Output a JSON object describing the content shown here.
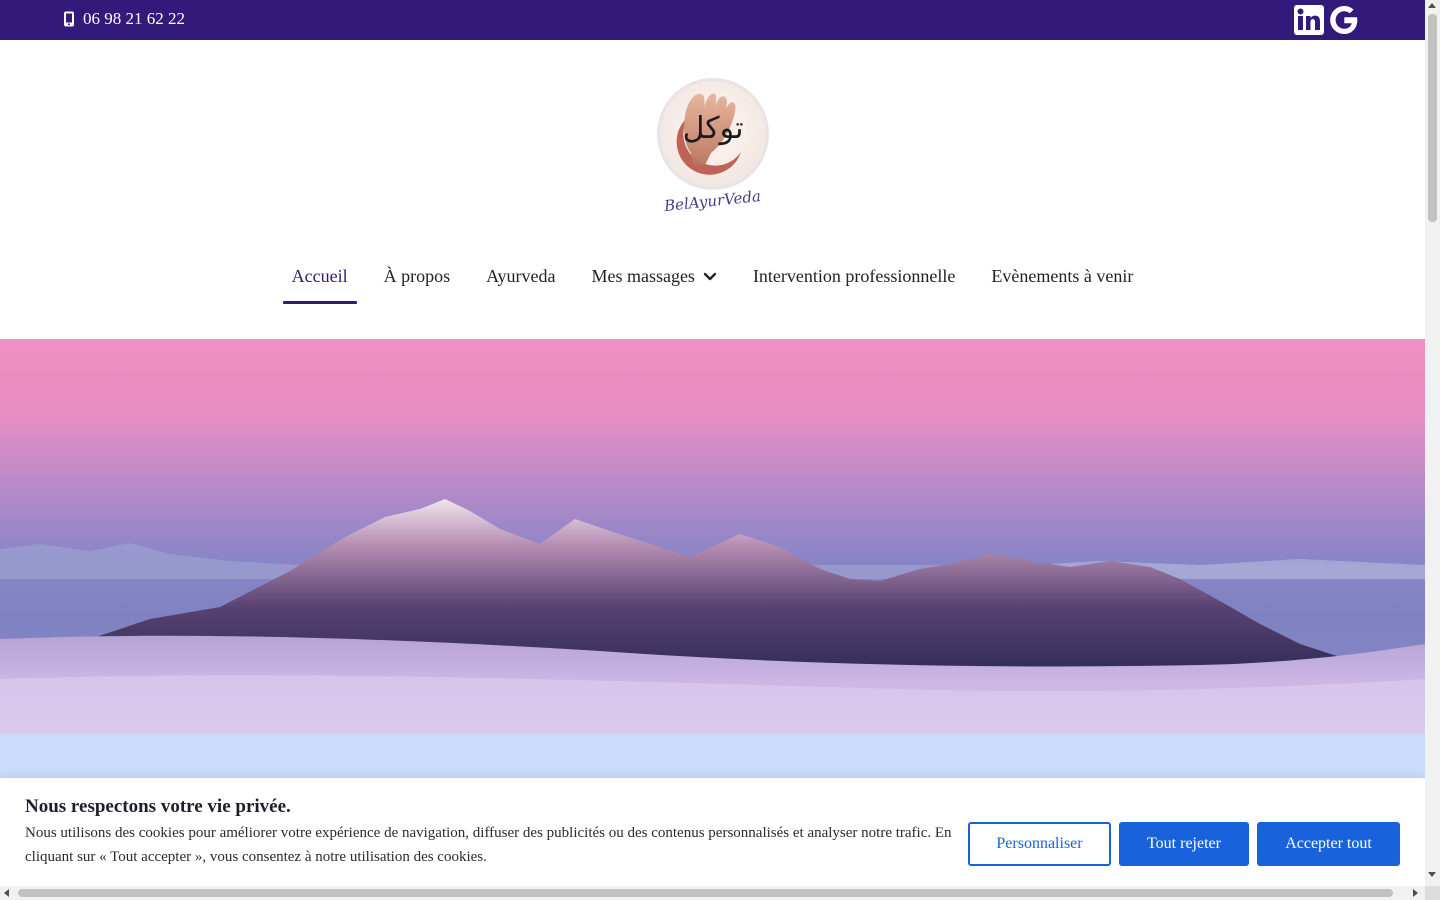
{
  "topbar": {
    "phone": "06 98 21 62 22",
    "phone_icon": "mobile-phone-icon",
    "social": [
      {
        "name": "linkedin-icon",
        "label": "in"
      },
      {
        "name": "google-icon",
        "label": "G"
      }
    ],
    "color": "#33197a"
  },
  "logo": {
    "arabic": "توكل",
    "signature": "BelAyurVeda"
  },
  "nav": {
    "items": [
      {
        "label": "Accueil",
        "active": true
      },
      {
        "label": "À propos"
      },
      {
        "label": "Ayurveda"
      },
      {
        "label": "Mes massages",
        "has_dropdown": true
      },
      {
        "label": "Intervention professionnelle"
      },
      {
        "label": "Evènements à venir"
      }
    ]
  },
  "cookie": {
    "title": "Nous respectons votre vie privée.",
    "text": "Nous utilisons des cookies pour améliorer votre expérience de navigation, diffuser des publicités ou des contenus personnalisés et analyser notre trafic. En cliquant sur « Tout accepter », vous consentez à notre utilisation des cookies.",
    "customize_label": "Personnaliser",
    "reject_label": "Tout rejeter",
    "accept_label": "Accepter tout",
    "accent": "#1863dc"
  }
}
